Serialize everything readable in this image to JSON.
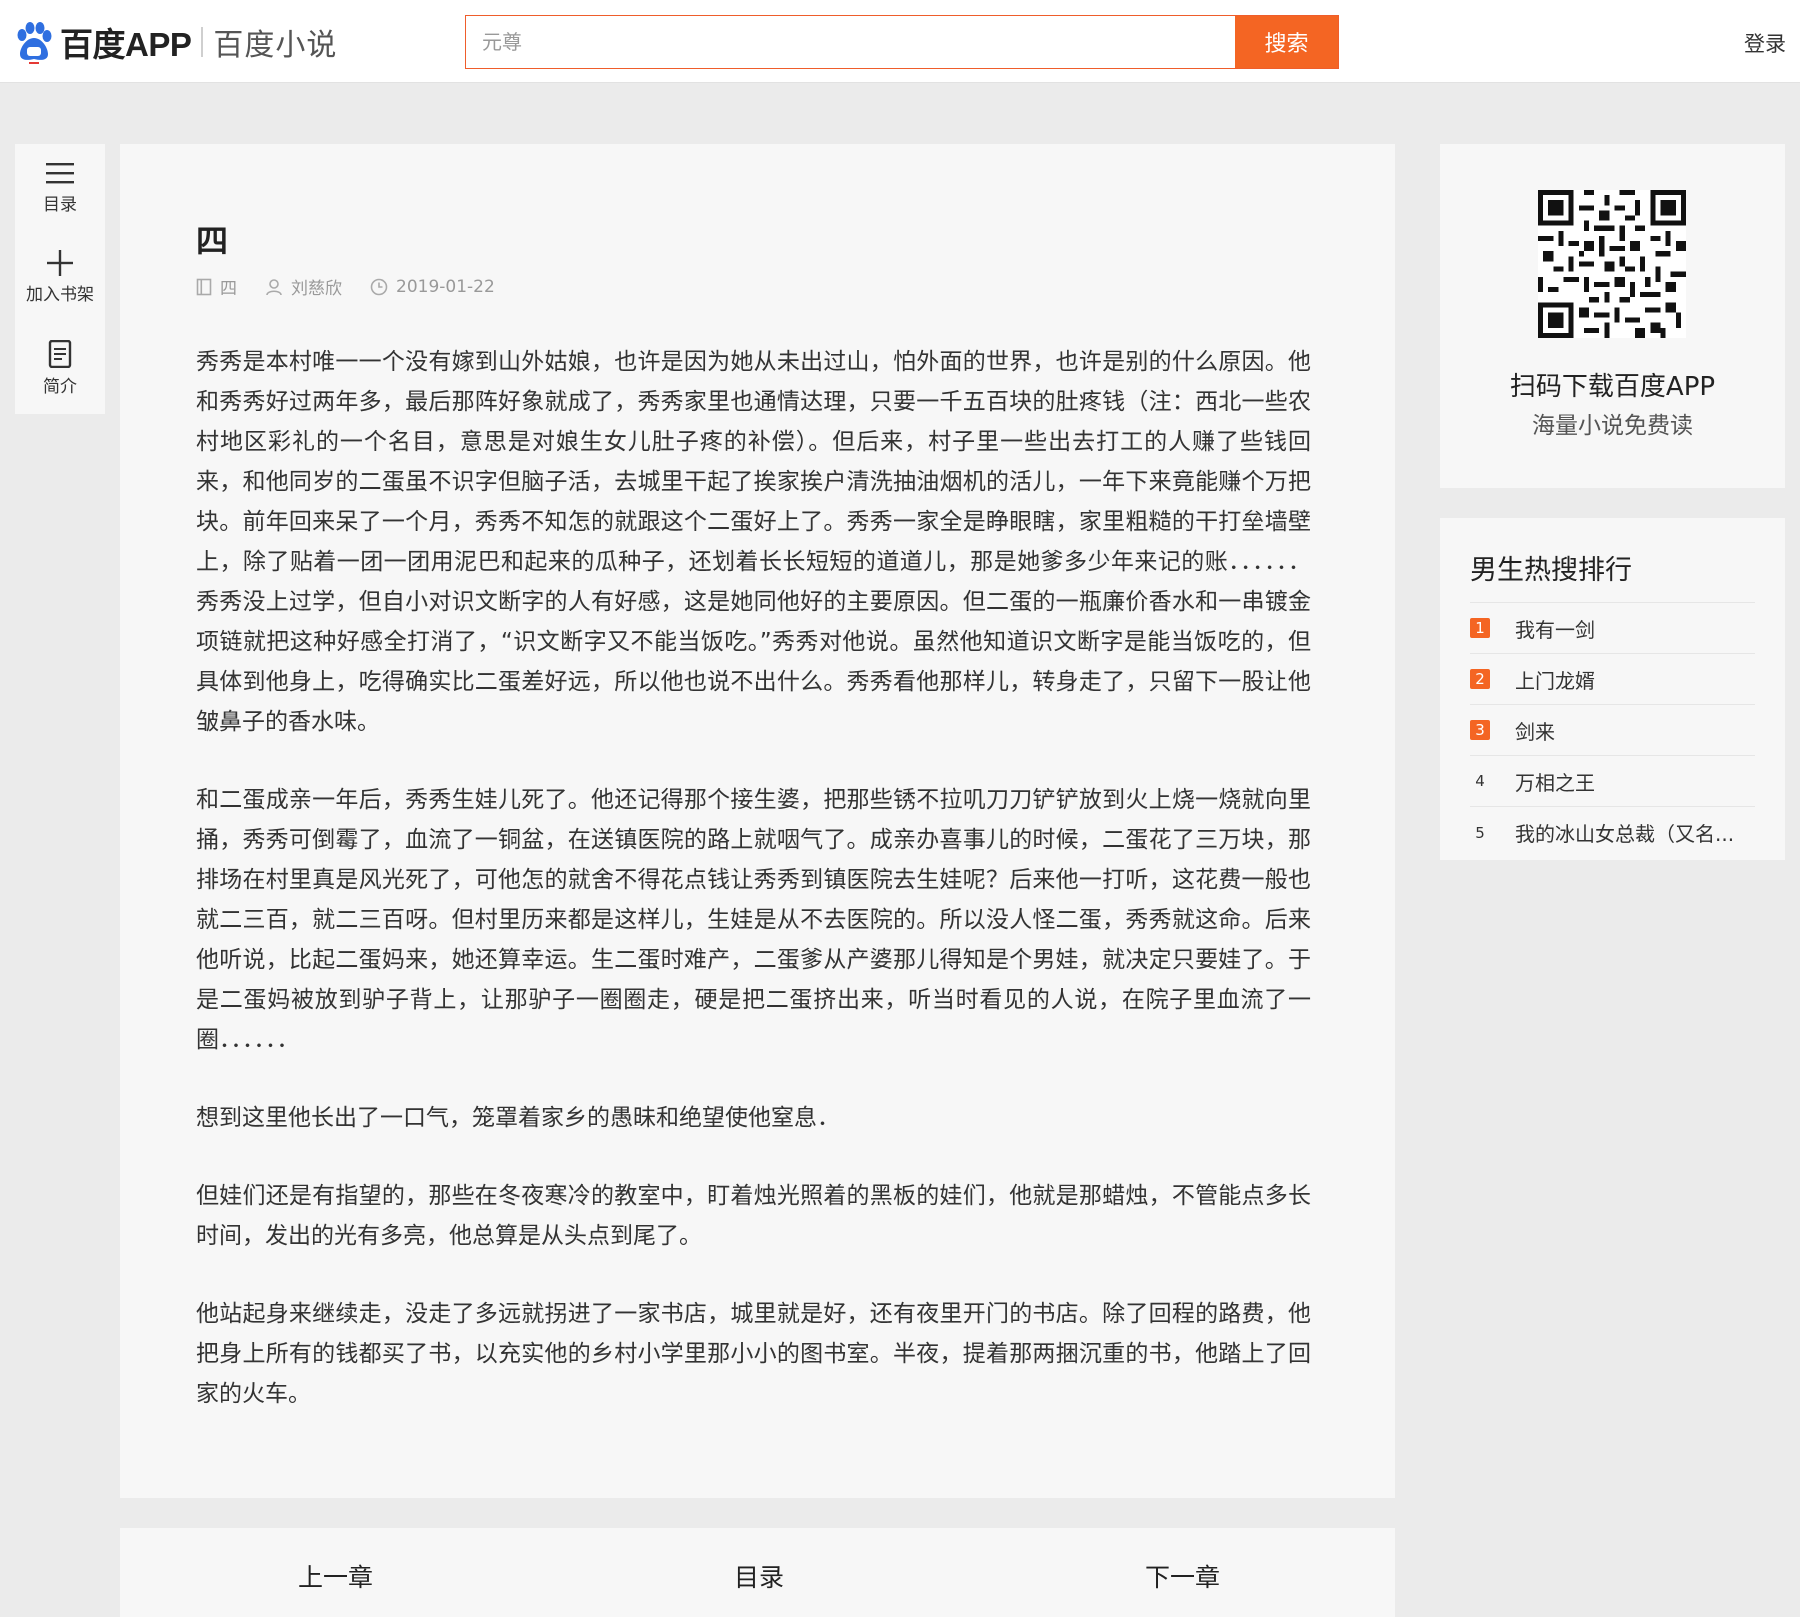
{
  "header": {
    "brand": "百度APP",
    "sub_brand": "百度小说",
    "search_placeholder": "元尊",
    "search_button": "搜索",
    "login": "登录"
  },
  "toolbar": {
    "items": [
      {
        "label": "目录",
        "icon": "menu-icon"
      },
      {
        "label": "加入书架",
        "icon": "plus-icon"
      },
      {
        "label": "简介",
        "icon": "document-icon"
      }
    ]
  },
  "article": {
    "title": "四",
    "meta": {
      "book": "四",
      "author": "刘慈欣",
      "date": "2019-01-22"
    },
    "paragraphs": [
      "秀秀是本村唯一一个没有嫁到山外姑娘，也许是因为她从未出过山，怕外面的世界，也许是别的什么原因。他和秀秀好过两年多，最后那阵好象就成了，秀秀家里也通情达理，只要一千五百块的肚疼钱（注：西北一些农村地区彩礼的一个名目，意思是对娘生女儿肚子疼的补偿）。但后来，村子里一些出去打工的人赚了些钱回来，和他同岁的二蛋虽不识字但脑子活，去城里干起了挨家挨户清洗抽油烟机的活儿，一年下来竟能赚个万把块。前年回来呆了一个月，秀秀不知怎的就跟这个二蛋好上了。秀秀一家全是睁眼瞎，家里粗糙的干打垒墙壁上，除了贴着一团一团用泥巴和起来的瓜种子，还划着长长短短的道道儿，那是她爹多少年来记的账．．．．．．秀秀没上过学，但自小对识文断字的人有好感，这是她同他好的主要原因。但二蛋的一瓶廉价香水和一串镀金项链就把这种好感全打消了，“识文断字又不能当饭吃。”秀秀对他说。虽然他知道识文断字是能当饭吃的，但具体到他身上，吃得确实比二蛋差好远，所以他也说不出什么。秀秀看他那样儿，转身走了，只留下一股让他皱鼻子的香水味。",
      "和二蛋成亲一年后，秀秀生娃儿死了。他还记得那个接生婆，把那些锈不拉叽刀刀铲铲放到火上烧一烧就向里捅，秀秀可倒霉了，血流了一铜盆，在送镇医院的路上就咽气了。成亲办喜事儿的时候，二蛋花了三万块，那排场在村里真是风光死了，可他怎的就舍不得花点钱让秀秀到镇医院去生娃呢？后来他一打听，这花费一般也就二三百，就二三百呀。但村里历来都是这样儿，生娃是从不去医院的。所以没人怪二蛋，秀秀就这命。后来他听说，比起二蛋妈来，她还算幸运。生二蛋时难产，二蛋爹从产婆那儿得知是个男娃，就决定只要娃了。于是二蛋妈被放到驴子背上，让那驴子一圈圈走，硬是把二蛋挤出来，听当时看见的人说，在院子里血流了一圈．．．．．．",
      "想到这里他长出了一口气，笼罩着家乡的愚昧和绝望使他窒息．",
      "但娃们还是有指望的，那些在冬夜寒冷的教室中，盯着烛光照着的黑板的娃们，他就是那蜡烛，不管能点多长时间，发出的光有多亮，他总算是从头点到尾了。",
      "他站起身来继续走，没走了多远就拐进了一家书店，城里就是好，还有夜里开门的书店。除了回程的路费，他把身上所有的钱都买了书，以充实他的乡村小学里那小小的图书室。半夜，提着那两捆沉重的书，他踏上了回家的火车。"
    ]
  },
  "chapter_nav": {
    "prev": "上一章",
    "toc": "目录",
    "next": "下一章"
  },
  "qr_card": {
    "title": "扫码下载百度APP",
    "subtitle": "海量小说免费读"
  },
  "ranking": {
    "title": "男生热搜排行",
    "items": [
      {
        "rank": "1",
        "name": "我有一剑"
      },
      {
        "rank": "2",
        "name": "上门龙婿"
      },
      {
        "rank": "3",
        "name": "剑来"
      },
      {
        "rank": "4",
        "name": "万相之王"
      },
      {
        "rank": "5",
        "name": "我的冰山女总裁（又名..."
      }
    ]
  },
  "colors": {
    "accent": "#f46523",
    "page_bg": "#ebebeb",
    "card_bg": "#f7f7f7"
  }
}
